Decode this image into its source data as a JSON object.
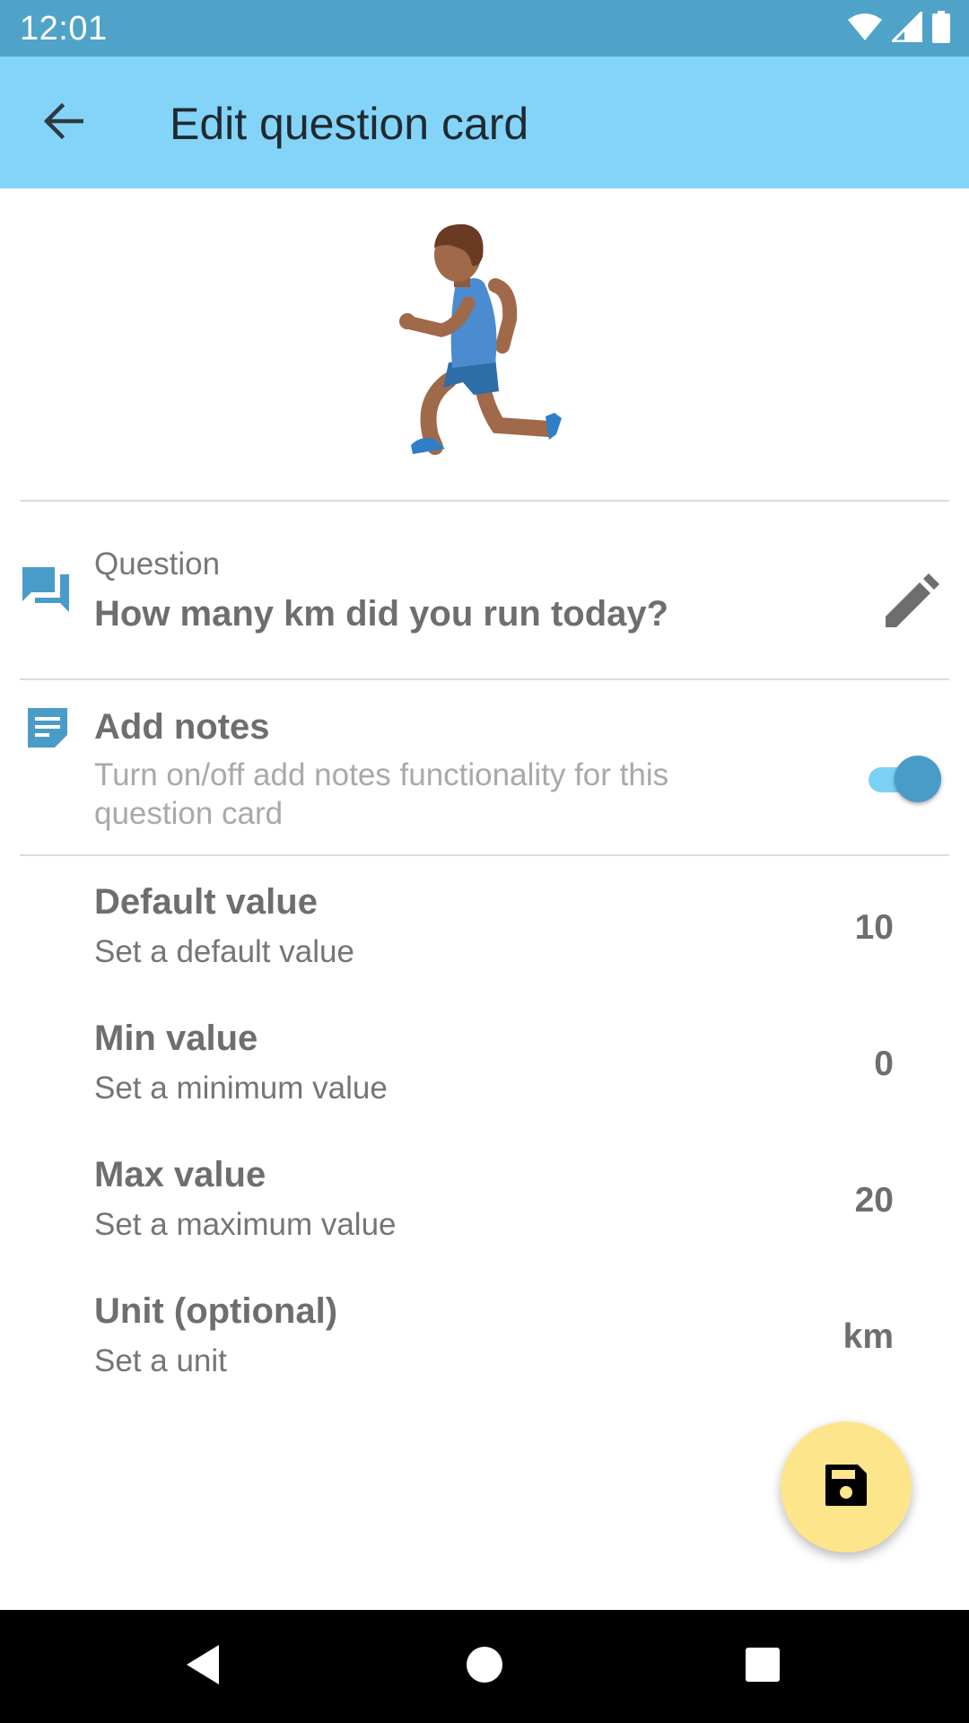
{
  "status_bar": {
    "time": "12:01",
    "icons": [
      "wifi-icon",
      "signal-icon",
      "battery-icon"
    ]
  },
  "app_bar": {
    "title": "Edit question card",
    "back_icon": "arrow-back-icon",
    "background": "#83d4f8"
  },
  "hero": {
    "emoji": "person-running-icon"
  },
  "question": {
    "icon": "forum-icon",
    "caption": "Question",
    "text": "How many km did you run today?",
    "edit_icon": "pencil-icon"
  },
  "notes": {
    "icon": "notes-icon",
    "title": "Add notes",
    "description": "Turn on/off add notes functionality for this question card",
    "enabled": true
  },
  "settings": [
    {
      "title": "Default value",
      "subtitle": "Set a default value",
      "value": "10"
    },
    {
      "title": "Min value",
      "subtitle": "Set a minimum value",
      "value": "0"
    },
    {
      "title": "Max value",
      "subtitle": "Set a maximum value",
      "value": "20"
    },
    {
      "title": "Unit (optional)",
      "subtitle": "Set a unit",
      "value": "km"
    }
  ],
  "fab": {
    "icon": "save-icon",
    "color": "#fde58c"
  },
  "nav_bar": {
    "icons": [
      "back-triangle-icon",
      "home-circle-icon",
      "recents-square-icon"
    ]
  },
  "colors": {
    "status_bar": "#4fa3c9",
    "accent_icon": "#4a9cc8"
  }
}
